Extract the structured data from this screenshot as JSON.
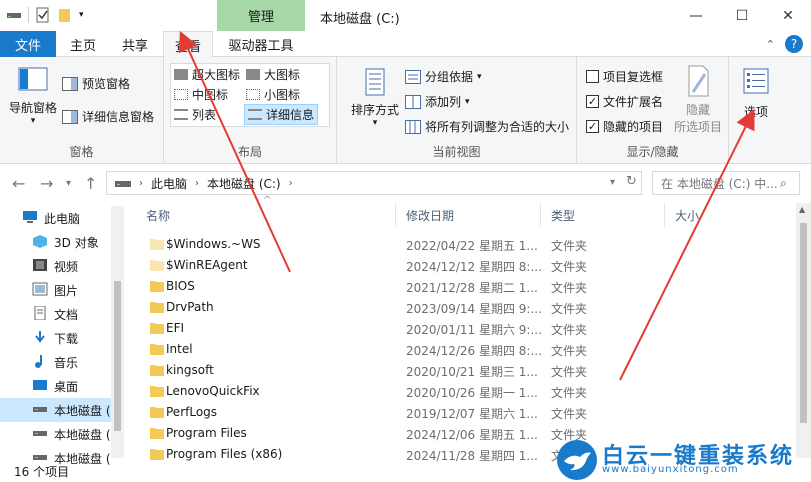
{
  "window": {
    "title": "本地磁盘 (C:)",
    "context_tab_title": "管理",
    "minimize": "—",
    "maximize": "☐",
    "close": "✕"
  },
  "tabs": {
    "file": "文件",
    "home": "主页",
    "share": "共享",
    "view": "查看",
    "drive_tools": "驱动器工具"
  },
  "ribbon": {
    "panes": {
      "nav_pane": "导航窗格",
      "preview_pane": "预览窗格",
      "details_pane": "详细信息窗格",
      "label": "窗格"
    },
    "layout": {
      "xl_icons": "超大图标",
      "large_icons": "大图标",
      "medium_icons": "中图标",
      "small_icons": "小图标",
      "list": "列表",
      "details": "详细信息",
      "label": "布局"
    },
    "current_view": {
      "sort_by": "排序方式",
      "group_by": "分组依据",
      "add_column": "添加列",
      "size_all_columns": "将所有列调整为合适的大小",
      "label": "当前视图"
    },
    "show_hide": {
      "item_checkboxes": "项目复选框",
      "item_checkboxes_checked": false,
      "file_extensions": "文件扩展名",
      "file_extensions_checked": true,
      "hidden_items": "隐藏的项目",
      "hidden_items_checked": true,
      "hide_selected_line1": "隐藏",
      "hide_selected_line2": "所选项目",
      "label": "显示/隐藏"
    },
    "options": "选项"
  },
  "address": {
    "crumb_pc": "此电脑",
    "crumb_drive": "本地磁盘 (C:)",
    "search_placeholder": "在 本地磁盘 (C:) 中..."
  },
  "nav_pane": {
    "items": [
      {
        "label": "此电脑",
        "icon": "computer-icon"
      },
      {
        "label": "3D 对象",
        "icon": "cube-icon"
      },
      {
        "label": "视频",
        "icon": "video-icon"
      },
      {
        "label": "图片",
        "icon": "picture-icon"
      },
      {
        "label": "文档",
        "icon": "document-icon"
      },
      {
        "label": "下载",
        "icon": "download-icon"
      },
      {
        "label": "音乐",
        "icon": "music-icon"
      },
      {
        "label": "桌面",
        "icon": "desktop-icon"
      },
      {
        "label": "本地磁盘 (",
        "icon": "drive-icon"
      },
      {
        "label": "本地磁盘 (",
        "icon": "drive-icon"
      },
      {
        "label": "本地磁盘 (",
        "icon": "drive-icon"
      }
    ]
  },
  "columns": {
    "name": "名称",
    "date": "修改日期",
    "type": "类型",
    "size": "大小"
  },
  "files": [
    {
      "name": "$Windows.~WS",
      "date": "2022/04/22 星期五 1...",
      "type": "文件夹",
      "hidden": true
    },
    {
      "name": "$WinREAgent",
      "date": "2024/12/12 星期四 8:...",
      "type": "文件夹",
      "hidden": true
    },
    {
      "name": "BIOS",
      "date": "2021/12/28 星期二 1...",
      "type": "文件夹",
      "hidden": false
    },
    {
      "name": "DrvPath",
      "date": "2023/09/14 星期四 9:...",
      "type": "文件夹",
      "hidden": false
    },
    {
      "name": "EFI",
      "date": "2020/01/11 星期六 9:...",
      "type": "文件夹",
      "hidden": false
    },
    {
      "name": "Intel",
      "date": "2024/12/26 星期四 8:...",
      "type": "文件夹",
      "hidden": false
    },
    {
      "name": "kingsoft",
      "date": "2020/10/21 星期三 1...",
      "type": "文件夹",
      "hidden": false
    },
    {
      "name": "LenovoQuickFix",
      "date": "2020/10/26 星期一 1...",
      "type": "文件夹",
      "hidden": false
    },
    {
      "name": "PerfLogs",
      "date": "2019/12/07 星期六 1...",
      "type": "文件夹",
      "hidden": false
    },
    {
      "name": "Program Files",
      "date": "2024/12/06 星期五 1...",
      "type": "文件夹",
      "hidden": false
    },
    {
      "name": "Program Files (x86)",
      "date": "2024/11/28 星期四 1...",
      "type": "文件夹",
      "hidden": false
    }
  ],
  "status": {
    "item_count": "16 个项目"
  },
  "watermark": {
    "title": "白云一键重装系统",
    "url": "www.baiyunxitong.com"
  },
  "colors": {
    "accent": "#1979ca",
    "context_tab": "#a7d8a7",
    "selection": "#cce8ff",
    "folder": "#f5c955",
    "annotation_arrow": "#e53935"
  }
}
